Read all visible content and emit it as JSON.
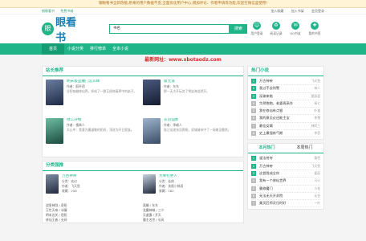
{
  "notice": "钢眼看书全新改版,原来的用户数据不变,全面优化用户中心,增加评论、作者申请等功能,欢迎在微信里使用!",
  "topbar": {
    "links": [
      "钢眼看书",
      "免费书城"
    ],
    "right": [
      "加入收藏",
      "加入书架",
      "会员登录"
    ]
  },
  "logo": {
    "mark": "眼",
    "name": "眼看书"
  },
  "search": {
    "value": "书名",
    "button": "搜索"
  },
  "header_icons": [
    {
      "icon": "user-icon",
      "glyph": "☺",
      "label": "用户登录"
    },
    {
      "icon": "history-icon",
      "glyph": "♻",
      "label": "阅读记录"
    },
    {
      "icon": "qq-icon",
      "glyph": "✉",
      "label": "QQ书友"
    },
    {
      "icon": "bookmark-icon",
      "glyph": "✚",
      "label": "我的书签"
    }
  ],
  "nav": [
    "首页",
    "小说分类",
    "排行榜单",
    "全本小说"
  ],
  "banner": "最新网址：www.xbotaodz.com",
  "recommend": {
    "title": "站长推荐",
    "books": [
      {
        "title": "明末极品魔门怎么样",
        "author": "作者：醉阡陌",
        "desc": "谷阳穿越修仙界，却成了一群正经修真界中的弟子。",
        "cover": "#3a4c6e"
      },
      {
        "title": "极无道",
        "author": "作者：东东",
        "desc": "那一天大开玩笑了将宙海浩然开。",
        "cover": "#2b3a58"
      },
      {
        "title": "绿工开物",
        "author": "作者：楼典人",
        "desc": "天山中：宽意为最道敬的奶奶，顶进为开日家族。",
        "cover": "#2c6e5f"
      },
      {
        "title": "衣冠仙葬",
        "author": "作者：季峻人",
        "desc": "陆江仙池衣冠两侧，须城城市中了一场美见雷然。",
        "cover": "#5a708c"
      }
    ]
  },
  "category": {
    "title": "分类强推",
    "books": [
      {
        "title": "万古神帝",
        "type": "分类：玄幻",
        "author": "作者：飞天鱼",
        "words": "收藏：256",
        "cover": "#3d4a5e"
      },
      {
        "title": "大奉打更人",
        "type": "分类：仙侠",
        "author": "作者：卖报小郎君",
        "words": "收藏：182",
        "cover": "#253045"
      }
    ],
    "list": [
      "战皇神剑 / 奇阳",
      "离婚 / 东东",
      "万世天帝 / 冰凝",
      "龙魔神域 / 三少",
      "明末边关 / 阳阳",
      "天道霸 / 开天",
      "修仙王者 / 无间",
      "霸主名宗 / 长风"
    ]
  },
  "hot": {
    "title": "热门小说",
    "items": [
      {
        "num": "1",
        "title": "万古神帝",
        "author": "飞天鱼"
      },
      {
        "num": "2",
        "title": "我过不苦刑警",
        "author": "林人"
      },
      {
        "num": "3",
        "title": "深渊来临",
        "author": "星辰君"
      },
      {
        "num": "4",
        "title": "华然抱抱，老婆再高作",
        "author": "瑶七"
      },
      {
        "num": "5",
        "title": "我在修仙有点狠",
        "author": "叶道"
      },
      {
        "num": "6",
        "title": "我的意见论还能主宝",
        "author": "李雪"
      },
      {
        "num": "7",
        "title": "最佳女婿",
        "author": "林阿三"
      },
      {
        "num": "8",
        "title": "史上最强炼气期",
        "author": "李哲"
      }
    ]
  },
  "month": {
    "tabs": [
      "本月热门",
      "本周热门"
    ],
    "items": [
      {
        "num": "1",
        "title": "道法苍穹",
        "author": "暮色"
      },
      {
        "num": "2",
        "title": "万古神帝",
        "author": "飞天鱼"
      },
      {
        "num": "3",
        "title": "这首我成全你",
        "author": "星辰"
      },
      {
        "num": "4",
        "title": "我有一个修仙世界",
        "author": "马火"
      },
      {
        "num": "5",
        "title": "霸修魔门",
        "author": "小花"
      },
      {
        "num": "6",
        "title": "无法无天开封院",
        "author": "无名"
      },
      {
        "num": "7",
        "title": "美灵后师灵位时好",
        "author": "一叶"
      }
    ]
  }
}
